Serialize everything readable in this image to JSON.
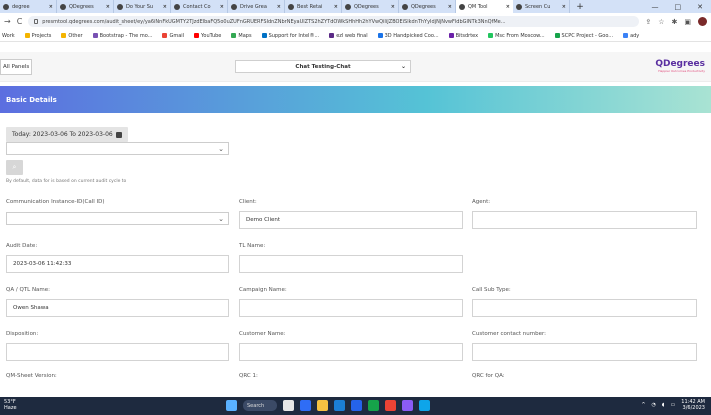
{
  "browser": {
    "tabs": [
      {
        "label": "degree"
      },
      {
        "label": "QDegrees"
      },
      {
        "label": "Do Your Su"
      },
      {
        "label": "Contact Co"
      },
      {
        "label": "Drive Grea"
      },
      {
        "label": "Best Retai"
      },
      {
        "label": "QDegrees"
      },
      {
        "label": "QDegrees"
      },
      {
        "label": "QM Tool",
        "active": true
      },
      {
        "label": "Screen Cu"
      }
    ],
    "url": "presmtool.qdegrees.com/audit_sheet/ey/ya6iNnFkUGMTY2TJzdElbaFQ5o0uZUFnGRUERFSIdnZNbrNEyaUlZTS2hZYTdOWkSHhHh2hYVwQiIiJZBOEiSlkdnThYyIdjNjNvwFldbGlNTk3NnQfMe...",
    "window_controls": [
      "—",
      "□",
      "✕"
    ],
    "bookmarks": [
      {
        "label": "Work",
        "color": "#ffffff"
      },
      {
        "label": "Projects",
        "color": "#f4b400"
      },
      {
        "label": "Other",
        "color": "#f4b400"
      },
      {
        "label": "Bootstrap - The mo...",
        "color": "#7952b3"
      },
      {
        "label": "Gmail",
        "color": "#ea4335"
      },
      {
        "label": "YouTube",
        "color": "#ff0000"
      },
      {
        "label": "Maps",
        "color": "#34a853"
      },
      {
        "label": "Support for Intel®...",
        "color": "#0071c5"
      },
      {
        "label": "ezl web final",
        "color": "#5b2a86"
      },
      {
        "label": "3D Handpicked Coo...",
        "color": "#1a73e8"
      },
      {
        "label": "Bitsdrtex",
        "color": "#6b21a8"
      },
      {
        "label": "Msc From Moscow...",
        "color": "#22c55e"
      },
      {
        "label": "SCPC Project - Goo...",
        "color": "#16a34a"
      },
      {
        "label": "ady",
        "color": "#3b82f6"
      }
    ]
  },
  "app": {
    "all_panels": "All Panels",
    "chat_selector": "Chat Testing-Chat",
    "logo_name": "QDegrees",
    "logo_tag": "Happier Outcomes Productivity"
  },
  "section": {
    "title": "Basic Details"
  },
  "form": {
    "date_range": "Today: 2023-03-06 To 2023-03-06",
    "filter_note": "By default, data for is based on current audit cycle to",
    "fields": {
      "communication_id": {
        "label": "Communication Instance-ID(Call ID)",
        "value": ""
      },
      "client": {
        "label": "Client:",
        "value": "Demo Client"
      },
      "agent": {
        "label": "Agent:",
        "value": ""
      },
      "audit_date": {
        "label": "Audit Date:",
        "value": "2023-03-06 11:42:33"
      },
      "tl_name": {
        "label": "TL Name:",
        "value": ""
      },
      "qa_name": {
        "label": "QA / QTL Name:",
        "value": "Owen Shawa"
      },
      "campaign_name": {
        "label": "Campaign Name:",
        "value": ""
      },
      "call_sub_type": {
        "label": "Call Sub Type:",
        "value": ""
      },
      "disposition": {
        "label": "Disposition:",
        "value": ""
      },
      "customer_name": {
        "label": "Customer Name:",
        "value": ""
      },
      "customer_contact": {
        "label": "Customer contact number:",
        "value": ""
      },
      "qm_sheet_version": {
        "label": "QM-Sheet Version:"
      },
      "qrc_1": {
        "label": "QRC 1:"
      },
      "qrc_for_qa": {
        "label": "QRC for QA:"
      }
    }
  },
  "taskbar": {
    "temperature": "53°F",
    "weather": "Haze",
    "search": "Search",
    "time": "11:42 AM",
    "date": "3/6/2023",
    "icon_colors": [
      "#5ab1ff",
      "#e7e7e7",
      "#2f6df6",
      "#f5c242",
      "#1b7fd6",
      "#2563eb",
      "#16a34a",
      "#ea4335",
      "#8b5cf6",
      "#0ea5e9"
    ]
  },
  "colors": {
    "section_gradient": [
      "#5c6ee0",
      "#55c3d6",
      "#a9e3d3"
    ],
    "logo_purple": "#5a2fa0"
  }
}
